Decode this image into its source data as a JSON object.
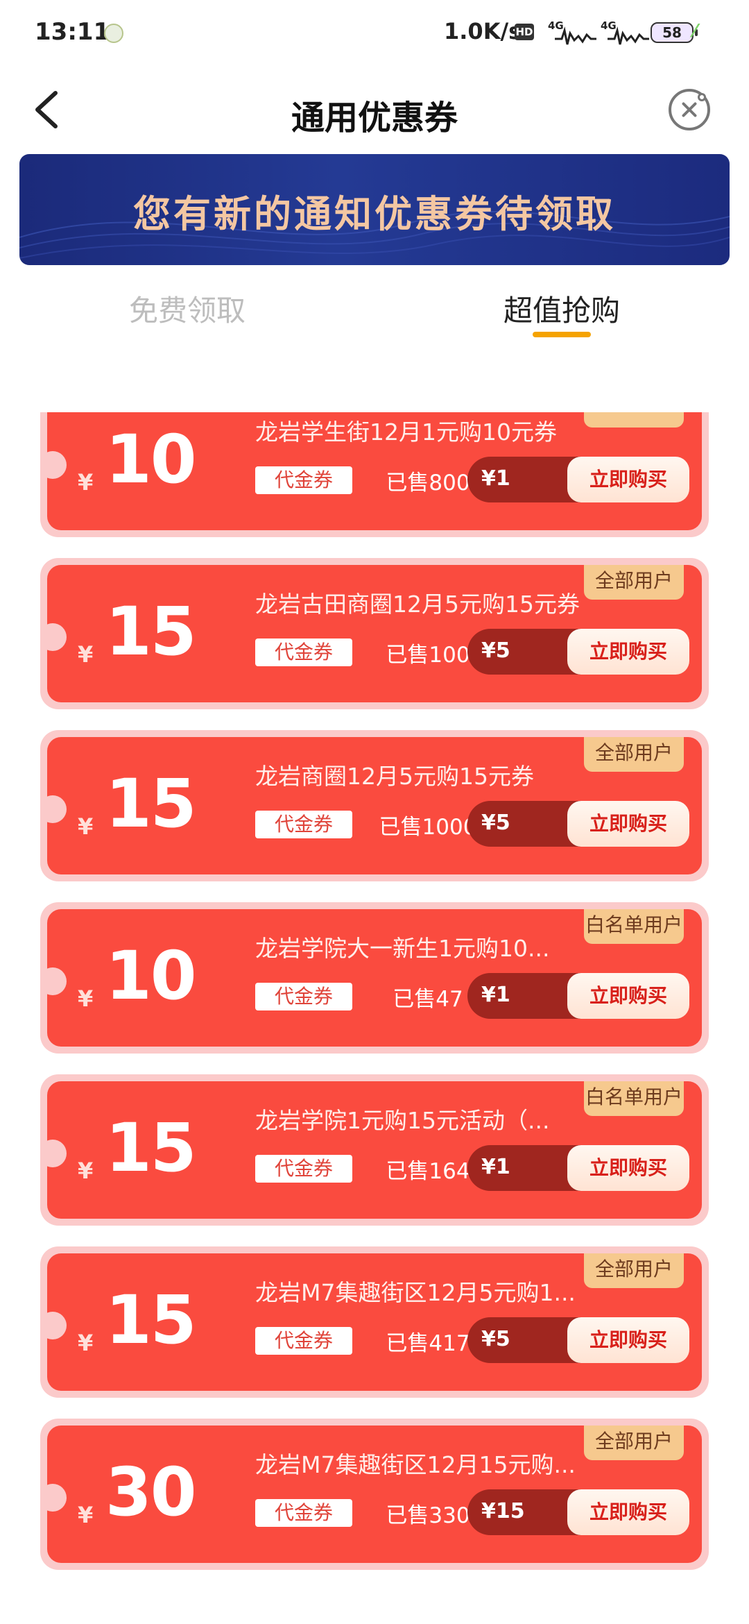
{
  "status_bar": {
    "time": "13:11",
    "net_speed": "1.0K/s",
    "hd": "HD",
    "sig1": "4G",
    "sig2": "4G",
    "battery": "58"
  },
  "header": {
    "title": "通用优惠券",
    "back_icon": "chevron-left-icon",
    "close_icon": "close-circle-icon"
  },
  "banner": {
    "text": "您有新的通知优惠券待领取"
  },
  "tabs": [
    {
      "label": "免费领取",
      "active": false
    },
    {
      "label": "超值抢购",
      "active": true
    }
  ],
  "coupons": [
    {
      "currency": "¥",
      "amount": "10",
      "title": "龙岩学生街12月1元购10元券",
      "badge": "",
      "type": "代金券",
      "sold": "已售800",
      "price": "¥1",
      "buy": "立即购买"
    },
    {
      "currency": "¥",
      "amount": "15",
      "title": "龙岩古田商圈12月5元购15元券",
      "badge": "全部用户",
      "type": "代金券",
      "sold": "已售100",
      "price": "¥5",
      "buy": "立即购买"
    },
    {
      "currency": "¥",
      "amount": "15",
      "title": "龙岩商圈12月5元购15元券",
      "badge": "全部用户",
      "type": "代金券",
      "sold": "已售1000",
      "price": "¥5",
      "buy": "立即购买"
    },
    {
      "currency": "¥",
      "amount": "10",
      "title": "龙岩学院大一新生1元购10...",
      "badge": "白名单用户",
      "type": "代金券",
      "sold": "已售47",
      "price": "¥1",
      "buy": "立即购买"
    },
    {
      "currency": "¥",
      "amount": "15",
      "title": "龙岩学院1元购15元活动（...",
      "badge": "白名单用户",
      "type": "代金券",
      "sold": "已售164",
      "price": "¥1",
      "buy": "立即购买"
    },
    {
      "currency": "¥",
      "amount": "15",
      "title": "龙岩M7集趣街区12月5元购1...",
      "badge": "全部用户",
      "type": "代金券",
      "sold": "已售417",
      "price": "¥5",
      "buy": "立即购买"
    },
    {
      "currency": "¥",
      "amount": "30",
      "title": "龙岩M7集趣街区12月15元购...",
      "badge": "全部用户",
      "type": "代金券",
      "sold": "已售330",
      "price": "¥15",
      "buy": "立即购买"
    }
  ],
  "colors": {
    "coupon_red": "#fa4b3f",
    "coupon_border": "#fbcaca",
    "badge_gold": "#f6c98e",
    "tab_underline": "#f5a300",
    "banner_blue": "#1b2a7a"
  }
}
